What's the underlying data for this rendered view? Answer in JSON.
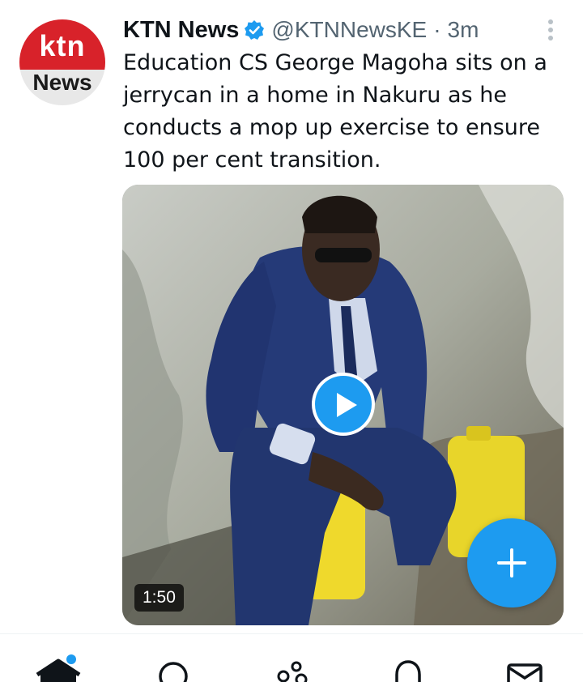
{
  "tweet": {
    "avatar": {
      "line1": "ktn",
      "line2": "News"
    },
    "name": "KTN News",
    "handle": "@KTNNewsKE",
    "separator": "·",
    "time": "3m",
    "text": "Education CS George Magoha sits on a jerrycan in a home in Nakuru as he conducts a mop up exercise to ensure 100 per cent transition.",
    "video": {
      "duration": "1:50"
    }
  },
  "icons": {
    "verified": "verified-badge-icon",
    "more": "more-vertical-icon",
    "play": "play-icon",
    "compose": "plus-icon",
    "nav": [
      "home-icon",
      "search-icon",
      "spaces-icon",
      "notifications-icon",
      "messages-icon"
    ]
  },
  "colors": {
    "accent": "#1d9bf0",
    "brand_red": "#d8222a",
    "muted": "#536471"
  }
}
